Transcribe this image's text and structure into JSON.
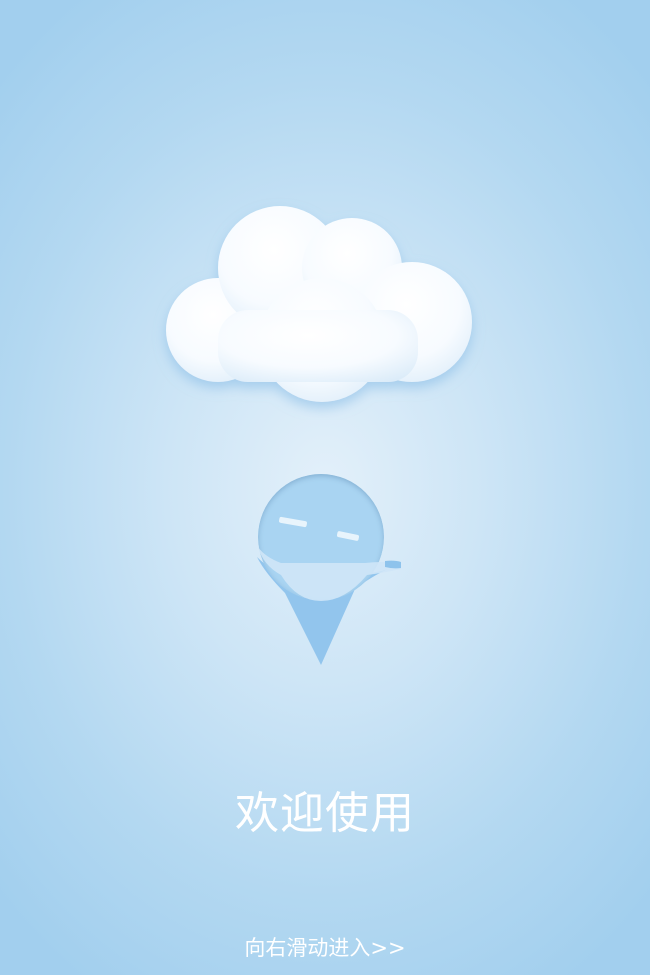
{
  "colors": {
    "background": "#b3d8f1",
    "cloud": "#ffffff",
    "mascot": "#8ec3ec",
    "text": "#ffffff"
  },
  "illustration": {
    "cloud_icon": "cloud-icon",
    "mascot_icon": "location-pin-mascot-icon"
  },
  "welcome": {
    "title": "欢迎使用"
  },
  "swipe": {
    "hint": "向右滑动进入>>"
  }
}
